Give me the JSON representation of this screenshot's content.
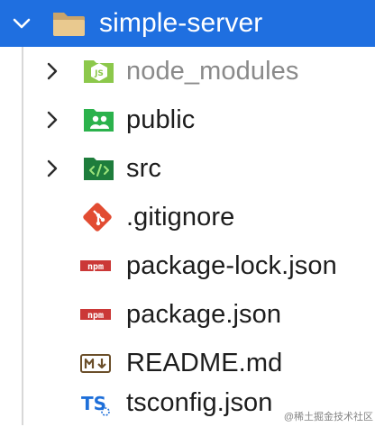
{
  "explorer": {
    "root": {
      "label": "simple-server",
      "expanded": true
    },
    "items": [
      {
        "label": "node_modules",
        "kind": "folder",
        "icon": "nodejs-folder-icon",
        "color": "#8cc84b",
        "muted": true
      },
      {
        "label": "public",
        "kind": "folder",
        "icon": "public-folder-icon",
        "color": "#2bb24c"
      },
      {
        "label": "src",
        "kind": "folder",
        "icon": "src-folder-icon",
        "color": "#1e7d3c"
      },
      {
        "label": ".gitignore",
        "kind": "file",
        "icon": "git-icon",
        "color": "#e24c32"
      },
      {
        "label": "package-lock.json",
        "kind": "file",
        "icon": "npm-icon",
        "color": "#cb3837"
      },
      {
        "label": "package.json",
        "kind": "file",
        "icon": "npm-icon",
        "color": "#cb3837"
      },
      {
        "label": "README.md",
        "kind": "file",
        "icon": "markdown-icon",
        "color": "#6b4f2a"
      },
      {
        "label": "tsconfig.json",
        "kind": "file",
        "icon": "typescript-icon",
        "color": "#1e6fd9"
      }
    ]
  },
  "watermark": "@稀土掘金技术社区",
  "colors": {
    "selection": "#1f6fe0",
    "text": "#1d1d1d",
    "muted_text": "#8a8a8a"
  }
}
